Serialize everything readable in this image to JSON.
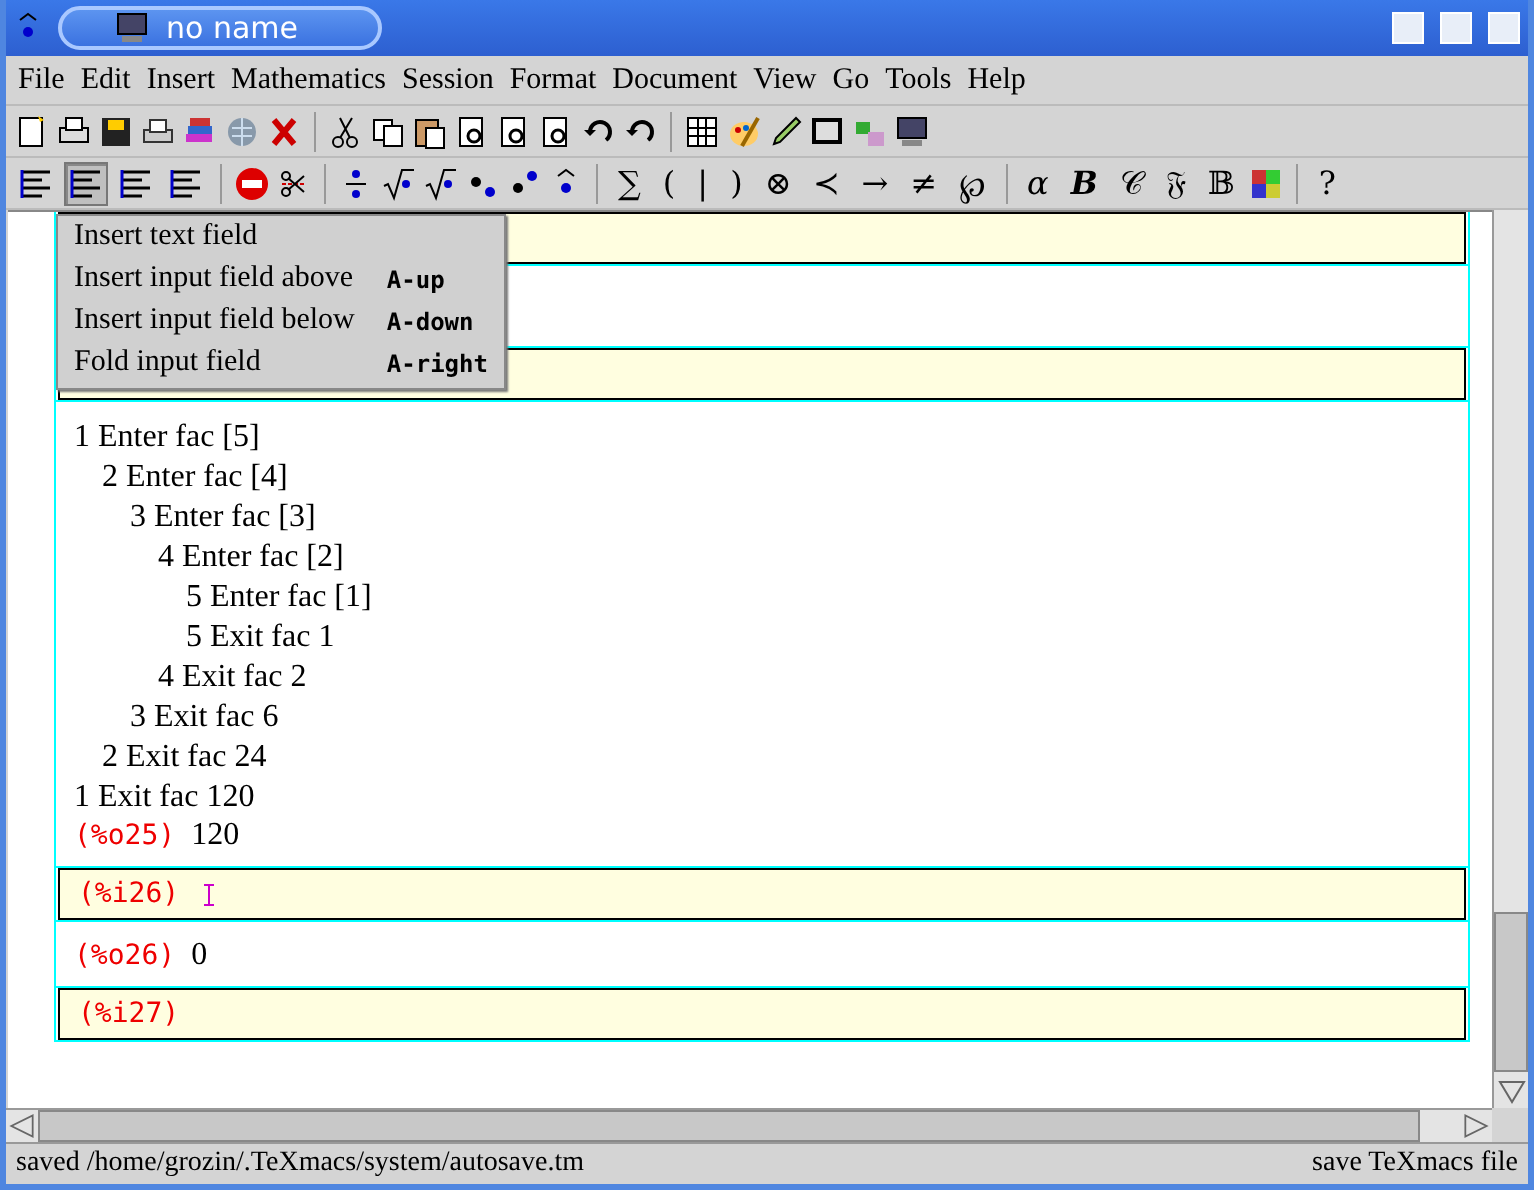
{
  "window": {
    "title": "no name"
  },
  "menu_bar": [
    "File",
    "Edit",
    "Insert",
    "Mathematics",
    "Session",
    "Format",
    "Document",
    "View",
    "Go",
    "Tools",
    "Help"
  ],
  "align_buttons": [
    {
      "selected": false
    },
    {
      "selected": true
    },
    {
      "selected": false
    },
    {
      "selected": false
    }
  ],
  "symbol_buttons": [
    "∑",
    "(",
    "|",
    ")",
    "⊗",
    "≺",
    "→",
    "≠",
    "℘"
  ],
  "style_buttons": [
    {
      "text": "α",
      "kind": "italic"
    },
    {
      "text": "B",
      "kind": "bold"
    },
    {
      "text": "𝒞",
      "kind": "plain"
    },
    {
      "text": "𝔉",
      "kind": "plain"
    },
    {
      "text": "𝔹",
      "kind": "plain"
    }
  ],
  "help_button": "?",
  "popup_menu": [
    {
      "label": "Insert text field"
    },
    {
      "label": "Insert input field above",
      "shortcut": "A-up"
    },
    {
      "label": "Insert input field below",
      "shortcut": "A-down"
    },
    {
      "label": "Fold input field",
      "shortcut": "A-right"
    }
  ],
  "session": [
    {
      "kind": "input"
    },
    {
      "kind": "output"
    },
    {
      "kind": "input"
    },
    {
      "kind": "output",
      "trace": [
        {
          "text": "1 Enter fac [5]",
          "children": [
            {
              "text": "2 Enter fac [4]",
              "children": [
                {
                  "text": "3 Enter fac [3]",
                  "children": [
                    {
                      "text": "4 Enter fac [2]",
                      "children": [
                        {
                          "text": "5 Enter fac [1]"
                        },
                        {
                          "text": "5 Exit fac 1"
                        }
                      ]
                    },
                    {
                      "text": "4 Exit fac 2"
                    }
                  ]
                },
                {
                  "text": "3 Exit fac 6"
                }
              ]
            },
            {
              "text": "2 Exit fac 24"
            }
          ]
        },
        {
          "text": "1 Exit fac 120"
        }
      ],
      "prompt": "(%o25)",
      "value": "120"
    },
    {
      "kind": "input",
      "prompt": "(%i26)",
      "cursor": true
    },
    {
      "kind": "output",
      "prompt": "(%o26)",
      "value": "0"
    },
    {
      "kind": "input",
      "prompt": "(%i27)",
      "cursor": false
    }
  ],
  "status_bar": {
    "left": "saved /home/grozin/.TeXmacs/system/autosave.tm",
    "right": "save TeXmacs file"
  }
}
